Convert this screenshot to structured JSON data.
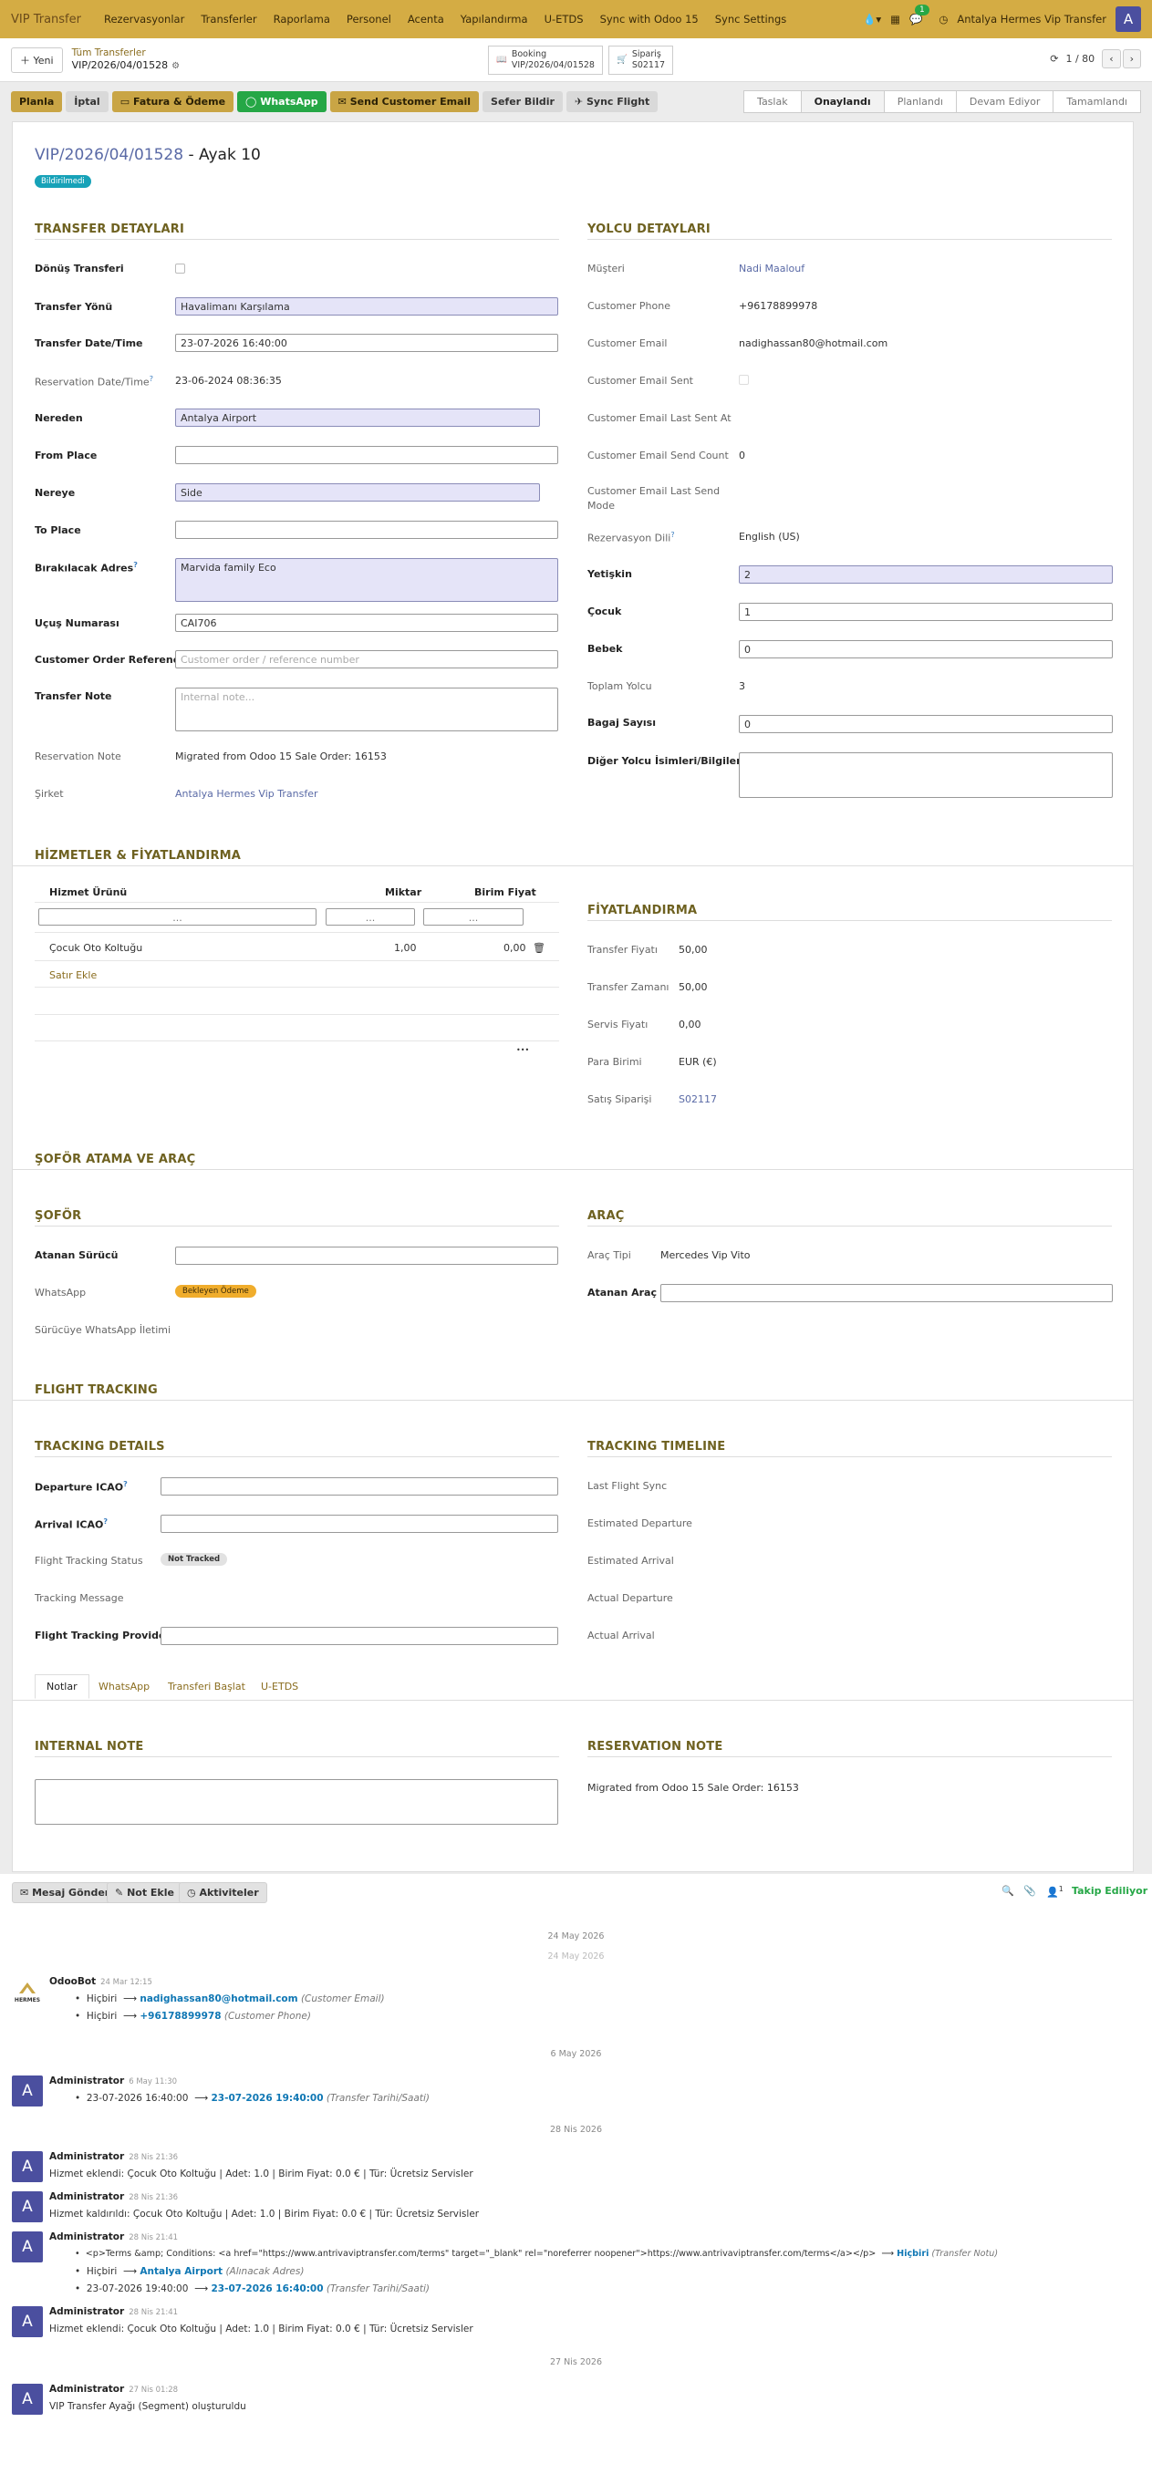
{
  "topbar": {
    "app_name": "VIP Transfer",
    "menu": [
      "Rezervasyonlar",
      "Transferler",
      "Raporlama",
      "Personel",
      "Acenta",
      "Yapılandırma",
      "U-ETDS",
      "Sync with Odoo 15",
      "Sync Settings"
    ],
    "notif_count": "1",
    "company": "Antalya Hermes Vip Transfer",
    "avatar": "A"
  },
  "control": {
    "new": "Yeni",
    "parent": "Tüm Transferler",
    "current": "VIP/2026/04/01528",
    "booking_label": "Booking",
    "booking_value": "VIP/2026/04/01528",
    "order_label": "Sipariş",
    "order_value": "S02117",
    "pager": "1 / 80"
  },
  "actions": {
    "planla": "Planla",
    "iptal": "İptal",
    "fatura": "Fatura & Ödeme",
    "whatsapp": "WhatsApp",
    "email": "Send Customer Email",
    "sefer": "Sefer Bildir",
    "sync": "Sync Flight"
  },
  "statusbar": [
    "Taslak",
    "Onaylandı",
    "Planlandı",
    "Devam Ediyor",
    "Tamamlandı"
  ],
  "record": {
    "id": "VIP/2026/04/01528",
    "suffix": " - Ayak 10",
    "badge": "Bildirilmedi"
  },
  "transfer": {
    "title": "TRANSFER DETAYLARI",
    "l_donus": "Dönüş Transferi",
    "l_yon": "Transfer Yönü",
    "v_yon": "Havalimanı Karşılama",
    "l_dt": "Transfer Date/Time",
    "v_dt": "23-07-2026 16:40:00",
    "l_rdt": "Reservation Date/Time",
    "v_rdt": "23-06-2024 08:36:35",
    "l_nereden": "Nereden",
    "v_nereden": "Antalya Airport",
    "l_from": "From Place",
    "l_nereye": "Nereye",
    "v_nereye": "Side",
    "l_to": "To Place",
    "l_adres": "Bırakılacak Adres",
    "v_adres": "Marvida family Eco",
    "l_ucus": "Uçuş Numarası",
    "v_ucus": "CAI706",
    "l_ref": "Customer Order Reference",
    "ph_ref": "Customer order / reference number",
    "l_note": "Transfer Note",
    "ph_note": "Internal note...",
    "l_rnote": "Reservation Note",
    "v_rnote": "Migrated from Odoo 15 Sale Order: 16153",
    "l_sirket": "Şirket",
    "v_sirket": "Antalya Hermes Vip Transfer"
  },
  "yolcu": {
    "title": "YOLCU DETAYLARI",
    "l_musteri": "Müşteri",
    "v_musteri": "Nadi Maalouf",
    "l_phone": "Customer Phone",
    "v_phone": "+96178899978",
    "l_email": "Customer Email",
    "v_email": "nadighassan80@hotmail.com",
    "l_sent": "Customer Email Sent",
    "l_lastat": "Customer Email Last Sent At",
    "l_count": "Customer Email Send Count",
    "v_count": "0",
    "l_mode": "Customer Email Last Send Mode",
    "l_dil": "Rezervasyon Dili",
    "v_dil": "English (US)",
    "l_yetiskin": "Yetişkin",
    "v_yetiskin": "2",
    "l_cocuk": "Çocuk",
    "v_cocuk": "1",
    "l_bebek": "Bebek",
    "v_bebek": "0",
    "l_toplam": "Toplam Yolcu",
    "v_toplam": "3",
    "l_bagaj": "Bagaj Sayısı",
    "v_bagaj": "0",
    "l_diger": "Diğer Yolcu İsimleri/Bilgileri"
  },
  "hizmet": {
    "title": "HİZMETLER & FİYATLANDIRMA",
    "th_urun": "Hizmet Ürünü",
    "th_miktar": "Miktar",
    "th_fiyat": "Birim Fiyat",
    "filter": "...",
    "row_urun": "Çocuk Oto Koltuğu",
    "row_miktar": "1,00",
    "row_fiyat": "0,00",
    "add": "Satır Ekle",
    "more": "•••"
  },
  "fiyat": {
    "title": "FİYATLANDIRMA",
    "l_transfer": "Transfer Fiyatı",
    "v_transfer": "50,00",
    "l_zaman": "Transfer Zamanı",
    "v_zaman": "50,00",
    "l_servis": "Servis Fiyatı",
    "v_servis": "0,00",
    "l_para": "Para Birimi",
    "v_para": "EUR (€)",
    "l_satis": "Satış Siparişi",
    "v_satis": "S02117"
  },
  "sofor_sec": {
    "title": "ŞOFÖR ATAMA VE ARAÇ",
    "sofor": "ŞOFÖR",
    "l_atanan": "Atanan Sürücü",
    "l_wa": "WhatsApp",
    "v_wa": "Bekleyen Ödeme",
    "l_swa": "Sürücüye WhatsApp İletimi",
    "arac": "ARAÇ",
    "l_tip": "Araç Tipi",
    "v_tip": "Mercedes Vip Vito",
    "l_atanan_arac": "Atanan Araç"
  },
  "flight": {
    "title": "FLIGHT TRACKING",
    "details": "TRACKING DETAILS",
    "l_dep": "Departure ICAO",
    "l_arr": "Arrival ICAO",
    "l_status": "Flight Tracking Status",
    "v_status": "Not Tracked",
    "l_msg": "Tracking Message",
    "l_prov": "Flight Tracking Provider",
    "timeline": "TRACKING TIMELINE",
    "l_last": "Last Flight Sync",
    "l_edep": "Estimated Departure",
    "l_earr": "Estimated Arrival",
    "l_adep": "Actual Departure",
    "l_aarr": "Actual Arrival"
  },
  "tabs": [
    "Notlar",
    "WhatsApp",
    "Transferi Başlat",
    "U-ETDS"
  ],
  "notes": {
    "internal": "INTERNAL NOTE",
    "reservation": "RESERVATION NOTE",
    "v_reservation": "Migrated from Odoo 15 Sale Order: 16153"
  },
  "chatter": {
    "send": "Mesaj Gönder",
    "note": "Not Ekle",
    "act": "Aktiviteler",
    "followers": "1",
    "following": "Takip Ediliyor",
    "d1": "24 May 2026",
    "d1b": "24 May 2026",
    "d2": "6 May 2026",
    "d3": "28 Nis 2026",
    "d4": "27 Nis 2026",
    "m1_author": "OdooBot",
    "m1_time": "24 Mar 12:15",
    "m1_l1_old": "Hiçbiri",
    "m1_l1_new": "nadighassan80@hotmail.com",
    "m1_l1_field": "(Customer Email)",
    "m1_l2_old": "Hiçbiri",
    "m1_l2_new": "+96178899978",
    "m1_l2_field": "(Customer Phone)",
    "m2_author": "Administrator",
    "m2_time": "6 May 11:30",
    "m2_old": "23-07-2026 16:40:00",
    "m2_new": "23-07-2026 19:40:00",
    "m2_field": "(Transfer Tarihi/Saati)",
    "m3_author": "Administrator",
    "m3_time": "28 Nis 21:36",
    "m3_text": "Hizmet eklendi: Çocuk Oto Koltuğu | Adet: 1.0 | Birim Fiyat: 0.0 € | Tür: Ücretsiz Servisler",
    "m4_author": "Administrator",
    "m4_time": "28 Nis 21:36",
    "m4_text": "Hizmet kaldırıldı: Çocuk Oto Koltuğu | Adet: 1.0 | Birim Fiyat: 0.0 € | Tür: Ücretsiz Servisler",
    "m5_author": "Administrator",
    "m5_time": "28 Nis 21:41",
    "m5_l1": "<p>Terms &amp; Conditions: <a href=\"https://www.antrivaviptransfer.com/terms\" target=\"_blank\" rel=\"noreferrer noopener\">https://www.antrivaviptransfer.com/terms</a></p>",
    "m5_l1_new": "Hiçbiri",
    "m5_l1_field": "(Transfer Notu)",
    "m5_l2_old": "Hiçbiri",
    "m5_l2_new": "Antalya Airport",
    "m5_l2_field": "(Alınacak Adres)",
    "m5_l3_old": "23-07-2026 19:40:00",
    "m5_l3_new": "23-07-2026 16:40:00",
    "m5_l3_field": "(Transfer Tarihi/Saati)",
    "m6_author": "Administrator",
    "m6_time": "28 Nis 21:41",
    "m6_text": "Hizmet eklendi: Çocuk Oto Koltuğu | Adet: 1.0 | Birim Fiyat: 0.0 € | Tür: Ücretsiz Servisler",
    "m7_author": "Administrator",
    "m7_time": "27 Nis 01:28",
    "m7_text": "VIP Transfer Ayağı (Segment) oluşturuldu",
    "logo_text": "HERMES"
  },
  "colors": {
    "topbar": "#d4ac44",
    "accent": "#6e6120",
    "link": "#5a6aa6",
    "green": "#25a746"
  }
}
